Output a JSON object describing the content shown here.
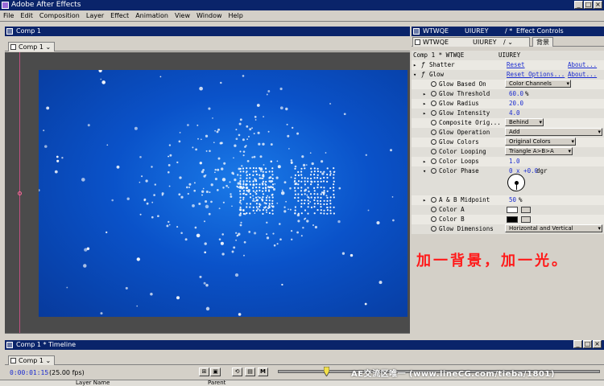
{
  "app": {
    "title": "Adobe After Effects"
  },
  "menu": [
    "File",
    "Edit",
    "Composition",
    "Layer",
    "Effect",
    "Animation",
    "View",
    "Window",
    "Help"
  ],
  "comp_window": {
    "title": "Comp 1",
    "tab": "Comp 1"
  },
  "effect_window": {
    "title_layer": "WTWQE",
    "title_name": "UIUREY",
    "title_label": "Effect Controls",
    "tab_layer": "WTWQE",
    "tab_name": "UIUREY",
    "tab_extra": "背景",
    "header_left": "Comp 1 * WTWQE",
    "header_right": "UIUREY",
    "effects": [
      {
        "name": "Shatter",
        "reset": "Reset",
        "about": "About..."
      },
      {
        "name": "Glow",
        "reset": "Reset Options...",
        "about": "About..."
      }
    ],
    "params": {
      "based_on": {
        "label": "Glow Based On",
        "value": "Color Channels"
      },
      "threshold": {
        "label": "Glow Threshold",
        "value": "60.0",
        "unit": "%"
      },
      "radius": {
        "label": "Glow Radius",
        "value": "20.0"
      },
      "intensity": {
        "label": "Glow Intensity",
        "value": "4.0"
      },
      "composite": {
        "label": "Composite Orig...",
        "value": "Behind"
      },
      "operation": {
        "label": "Glow Operation",
        "value": "Add"
      },
      "colors": {
        "label": "Glow Colors",
        "value": "Original Colors"
      },
      "looping": {
        "label": "Color Looping",
        "value": "Triangle A>B>A"
      },
      "loops": {
        "label": "Color Loops",
        "value": "1.0"
      },
      "phase": {
        "label": "Color Phase",
        "value": "0 x +0.0",
        "unit": "dgr"
      },
      "midpoint": {
        "label": "A & B Midpoint",
        "value": "50",
        "unit": "%"
      },
      "color_a": {
        "label": "Color A",
        "color": "#ffffff"
      },
      "color_b": {
        "label": "Color B",
        "color": "#000000"
      },
      "dimensions": {
        "label": "Glow Dimensions",
        "value": "Horizontal and Vertical"
      }
    }
  },
  "caption": "加一背景，加一光。",
  "timeline": {
    "title": "Comp 1 * Timeline",
    "tab": "Comp 1",
    "timecode": "0:00:01:15",
    "fps": "(25.00 fps)",
    "columns": [
      "Layer Name",
      "Parent"
    ]
  },
  "watermark": "AE交流区唯一 (www.lineCG.com/tieba/1801)",
  "colors": {
    "title_bar": "#0a246a",
    "canvas": "#0a52c9",
    "accent_text": "#1a2bd0",
    "caption": "#ff1a1a"
  }
}
